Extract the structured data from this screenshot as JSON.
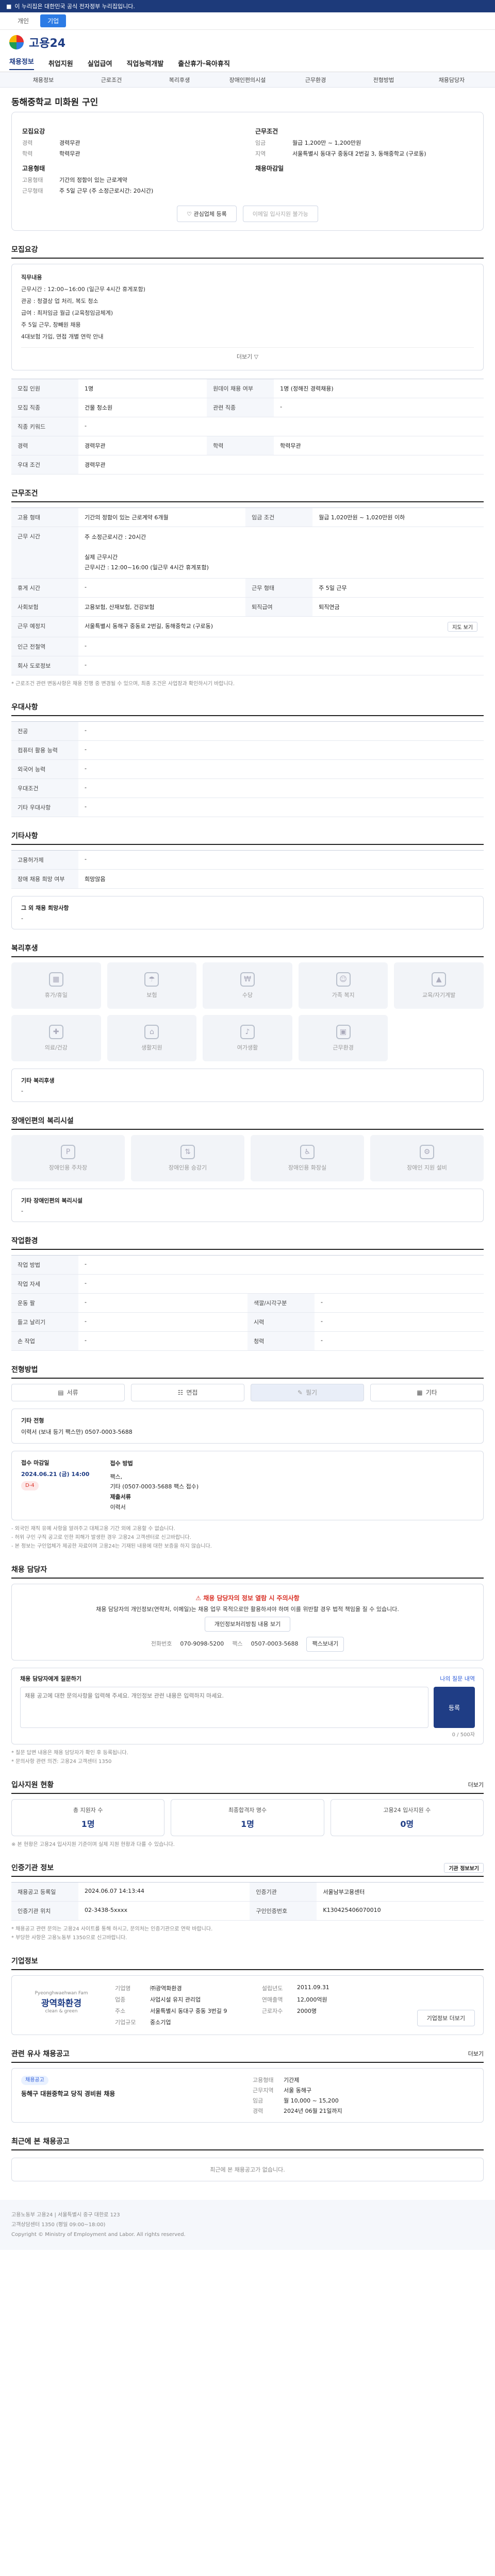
{
  "gov_bar": {
    "text": "이 누리집은 대한민국 공식 전자정부 누리집입니다."
  },
  "top_tabs": [
    "개인",
    "기업"
  ],
  "logo": {
    "text": "고용24"
  },
  "gnb": [
    "채용정보",
    "취업지원",
    "실업급여",
    "직업능력개발",
    "출산휴가·육아휴직"
  ],
  "lnb": [
    "채용정보",
    "근로조건",
    "복리후생",
    "장애인편의시설",
    "근무환경",
    "전형방법",
    "채용담당자"
  ],
  "title": "동해중학교 미화원 구인",
  "hero": {
    "recruit_label": "모집요강",
    "left": [
      [
        "경력",
        "경력무관"
      ],
      [
        "학력",
        "학력무관"
      ]
    ],
    "cond_label": "근무조건",
    "right": [
      [
        "임금",
        "월급 1,200만 ~ 1,200만원"
      ],
      [
        "지역",
        "서울특별시 동대구 중동대 2번길 3, 동해중학교 (구로동)"
      ]
    ],
    "sec2": "고용형태",
    "sec2_items": [
      [
        "고용형태",
        "기간의 정함이 있는 근로계약"
      ],
      [
        "근무형태",
        "주 5일 근무 (주 소정근로시간: 20시간)"
      ]
    ],
    "sec3": "채용마감일",
    "btn_interest": "관심업체 등록",
    "btn_apply": "이메일 입사지원 불가능"
  },
  "job_desc": {
    "title": "모집요강",
    "lines": [
      "직무내용",
      "근무시간 : 12:00~16:00 (일근무 4시간 휴게포함)",
      "관공 : 청결상 업 처리, 복도 청소",
      "급여 : 최저임금 월급 (교육청임금체계)",
      "주 5일 근무, 창빼원 채용",
      "4대보험 가입, 면접 개별 연락 안내"
    ],
    "more": "더보기 ▽"
  },
  "recruit_table": [
    [
      "모집 인원",
      "1명",
      "원데이 채용 여부",
      "1명 (정해진 경력채용)"
    ],
    [
      "모집 직종",
      "건물 청소원",
      "관련 직종",
      "-"
    ],
    [
      "직종 키워드",
      "-",
      "",
      ""
    ],
    [
      "경력",
      "경력무관",
      "학력",
      "학력무관"
    ],
    [
      "우대 조건",
      "경력무관",
      "",
      ""
    ]
  ],
  "work_cond": {
    "title": "근무조건",
    "rows": [
      [
        "고용 형태",
        "기간의 정함이 있는 근로계약  6개월",
        "임금 조건",
        "월급 1,020만원 ~ 1,020만원 이하"
      ],
      [
        "근무 시간",
        "주 소정근로시간 : 20시간\n\n실제 근무시간\n근무시간 : 12:00~16:00 (일근무 4시간 휴게포함)",
        "",
        ""
      ],
      [
        "휴게 시간",
        "-",
        "근무 형태",
        "주 5일 근무"
      ],
      [
        "사회보험",
        "고용보험, 산재보험, 건강보험",
        "퇴직급여",
        "퇴직연금"
      ],
      [
        "근무 예정지",
        "서울특별시 동해구 중동로 2번길, 동해중학교 (구로동)",
        "",
        ""
      ],
      [
        "인근 전철역",
        "-",
        "",
        ""
      ],
      [
        "회사 도로정보",
        "-",
        "",
        ""
      ]
    ],
    "map_btn": "지도 보기",
    "note": "* 근로조건 관련 변동사항은 채용 진행 중 변경될 수 있으며, 최종 조건은 사업장과 확인하시기 바랍니다."
  },
  "preferred": {
    "title": "우대사항",
    "rows": [
      [
        "전공",
        "-"
      ],
      [
        "컴퓨터 활용 능력",
        "-"
      ],
      [
        "외국어 능력",
        "-"
      ],
      [
        "우대조건",
        "-"
      ],
      [
        "기타 우대사항",
        "-"
      ]
    ]
  },
  "etc": {
    "title": "기타사항",
    "rows": [
      [
        "고용허가제",
        "-"
      ],
      [
        "장애 채용 희망 여부",
        "희망않음"
      ]
    ],
    "extra": "그 외 채용 희망사항",
    "extra_val": "-"
  },
  "welfare": {
    "title": "복리후생",
    "items": [
      "휴가/휴일",
      "보험",
      "수당",
      "가족 복지",
      "교육/자기계발",
      "의료/건강",
      "생활지원",
      "여가생활",
      "근무환경"
    ],
    "box_title": "기타 복리후생",
    "box_val": "-"
  },
  "access": {
    "title": "장애인편의 복리시설",
    "items": [
      "장애인용 주차장",
      "장애인용 승강기",
      "장애인용 화장실",
      "장애인 지원 설비"
    ],
    "box_title": "기타 장애인편의 복리시설",
    "box_val": "-"
  },
  "env": {
    "title": "작업환경",
    "rows": [
      [
        "작업 방법",
        "-",
        "",
        ""
      ],
      [
        "작업 자세",
        "-",
        "",
        ""
      ],
      [
        "운동 팔",
        "-",
        "색깔/시각구분",
        "-"
      ],
      [
        "들고 날리기",
        "-",
        "시력",
        "-"
      ],
      [
        "손 작업",
        "-",
        "청력",
        "-"
      ]
    ]
  },
  "apply": {
    "title": "전형방법",
    "tabs": [
      "서류",
      "면접",
      "필기",
      "기타"
    ],
    "other_label": "기타 전형",
    "other_val": "이력서 (보내 등기 팩스만) 0507-0003-5688",
    "period_label": "접수 마감일",
    "period_val": "2024.06.21 (금) 14:00",
    "dday": "D-4",
    "method_label": "접수 방법",
    "method_lines": [
      "팩스,",
      "기타 (0507-0003-5688 팩스 접수)",
      "제출서류",
      "이력서"
    ],
    "notes": [
      "- 외국인 재직 유예 사항을 알려주고 대체고용 기간 외에 고용할 수 없습니다.",
      "- 허위 구인 구직 공고로 인한 피해가 발생한 경우 고용24 고객센터로 신고바랍니다.",
      "- 본 정보는 구인업체가 제공한 자료이며 고용24는 기재된 내용에 대한 보증을 하지 않습니다."
    ]
  },
  "contact": {
    "title": "채용 담당자",
    "warn": "채용 담당자의 정보 열람 시 주의사항",
    "warn_text": "채용 담당자의 개인정보(연락처, 이메일)는 채용 업무 목적으로만 활용하셔야 하며 이를 위반할 경우 법적 책임을 질 수 있습니다.",
    "view_btn": "개인정보처리방침 내용 보기",
    "phone_label": "전화번호",
    "phone": "070-9098-5200",
    "fax_label": "팩스",
    "fax": "0507-0003-5688",
    "fax_btn": "팩스보내기",
    "inq_title": "채용 담당자에게 질문하기",
    "inq_right": "나의 질문 내역",
    "inq_ph": "채용 공고에 대한 문의사항을 입력해 주세요. 개인정보 관련 내용은 입력하지 마세요.",
    "inq_count": "0 / 500자",
    "inq_btn": "등록",
    "inq_notes": [
      "* 질문 답변 내용은 채용 담당자가 확인 후 등록됩니다.",
      "* 문의사항 관련 의견: 고용24 고객센터 1350"
    ]
  },
  "stats": {
    "title": "입사지원 현황",
    "more": "더보기",
    "items": [
      [
        "총 지원자 수",
        "1명"
      ],
      [
        "최종합격자 명수",
        "1명"
      ],
      [
        "고용24 입사지원 수",
        "0명"
      ]
    ],
    "note": "※ 본 현황은 고용24 입사지원 기준이며 실제 지원 현황과 다를 수 있습니다."
  },
  "org": {
    "title": "인증기관 정보",
    "btn": "기관 정보보기",
    "rows": [
      [
        "채용공고 등록일",
        "2024.06.07 14:13:44",
        "인증기관",
        "서울남부고용센터"
      ],
      [
        "인증기관 위치",
        "02-3438-5xxxx",
        "구인인증번호",
        "K130425406070010"
      ]
    ],
    "notes": [
      "* 채용공고 관련 문의는 고용24 사이트를 통해 하시고, 문의처는 인증기관으로 연락 바랍니다.",
      "* 부당한 사항은 고용노동부 1350으로 신고바랍니다."
    ]
  },
  "company": {
    "title": "기업정보",
    "logo_top": "Pyeonghwaehwan Fam",
    "logo": "광역화환경",
    "logo_sub": "clean & green",
    "fields": [
      [
        "기업명",
        "㈜광역화환경"
      ],
      [
        "설립년도",
        "2011.09.31"
      ],
      [
        "업종",
        "사업시설 유지 관리업"
      ],
      [
        "연매출액",
        "12,000억원"
      ],
      [
        "주소",
        "서울특별시 동대구 중동 3번길 9"
      ],
      [
        "근로자수",
        "2000명"
      ],
      [
        "기업규모",
        "중소기업",
        "",
        ""
      ]
    ],
    "info_btn": "기업정보 더보기"
  },
  "similar": {
    "title": "관련 유사 채용공고",
    "right": "더보기",
    "tag": "채용공고",
    "job": "동해구 대원중학교 당직 경비원 채용",
    "meta": [
      [
        "고용형태",
        "기간제"
      ],
      [
        "근무지역",
        "서울 동해구"
      ],
      [
        "임금",
        "월 10,000 ~ 15,200"
      ],
      [
        "경력",
        "2024년 06월 21일까지"
      ]
    ]
  },
  "recent": {
    "title": "최근에 본 채용공고",
    "empty": "최근에 본 채용공고가 없습니다."
  },
  "footer": [
    "고용노동부 고용24 | 서울특별시 중구 대한로 123",
    "고객상담센터 1350 (평일 09:00~18:00)",
    "Copyright © Ministry of Employment and Labor. All rights reserved."
  ]
}
